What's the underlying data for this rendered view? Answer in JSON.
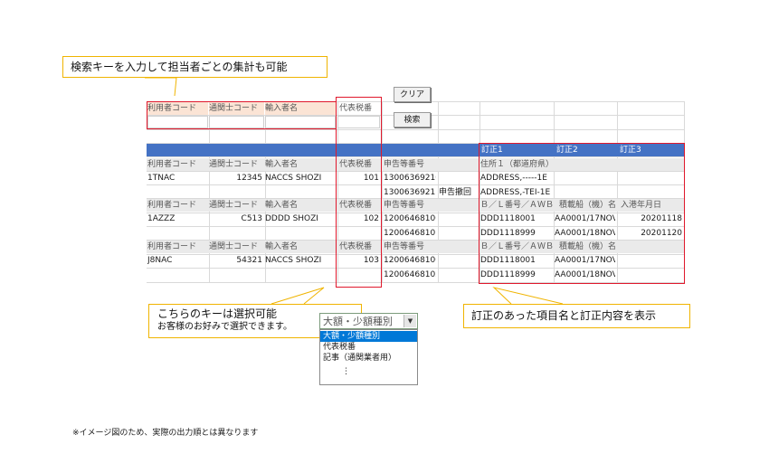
{
  "callouts": {
    "top": "検索キーを入力して担当者ごとの集計も可能",
    "left_line1": "こちらのキーは選択可能",
    "left_line2": "お客様のお好みで選択できます。",
    "right": "訂正のあった項目名と訂正内容を表示"
  },
  "search_form": {
    "headers": [
      "利用者コード",
      "通関士コード",
      "輸入者名",
      "代表税番"
    ],
    "clear_button": "クリア",
    "search_button": "検索"
  },
  "band": {
    "corrections": [
      "訂正1",
      "訂正2",
      "訂正3"
    ]
  },
  "groups": [
    {
      "headers": [
        "利用者コード",
        "通関士コード",
        "輸入者名",
        "代表税番",
        "申告等番号",
        "住所１（都道府県）"
      ],
      "rows": [
        [
          "1TNAC",
          "12345",
          "NACCS SHOZI",
          "101",
          "13006369210",
          "",
          "ADDRESS,-----1E",
          "",
          ""
        ],
        [
          "",
          "",
          "",
          "",
          "13006369211",
          "申告撤回",
          "ADDRESS,-TEI-1E",
          "",
          ""
        ]
      ]
    },
    {
      "headers": [
        "利用者コード",
        "通関士コード",
        "輸入者名",
        "代表税番",
        "申告等番号",
        "Ｂ／Ｌ番号／ＡＷＢ",
        "積載船（機）名",
        "入港年月日"
      ],
      "rows": [
        [
          "1AZZZ",
          "C513",
          "DDDD SHOZI",
          "102",
          "12006468100",
          "",
          "DDD1118001",
          "AA0001/17NOV",
          "20201118"
        ],
        [
          "",
          "",
          "",
          "",
          "12006468101",
          "",
          "DDD1118999",
          "AA0001/18NOV",
          "20201120"
        ]
      ]
    },
    {
      "headers": [
        "利用者コード",
        "通関士コード",
        "輸入者名",
        "代表税番",
        "申告等番号",
        "Ｂ／Ｌ番号／ＡＷＢ",
        "積載船（機）名"
      ],
      "rows": [
        [
          "J8NAC",
          "54321",
          "NACCS SHOZI",
          "103",
          "12006468100",
          "",
          "DDD1118001",
          "AA0001/17NOV",
          ""
        ],
        [
          "",
          "",
          "",
          "",
          "12006468102",
          "",
          "DDD1118999",
          "AA0001/18NOV",
          ""
        ]
      ]
    }
  ],
  "key_selector": {
    "selected": "大額・少額種別",
    "options": [
      "大額・少額種別",
      "代表税番",
      "記事（通関業者用）",
      "⋮"
    ]
  },
  "footnote": "※イメージ図のため、実際の出力順とは異なります",
  "colors": {
    "accent_red": "#e0182c",
    "band_blue": "#4472c4",
    "callout_border": "#f0b400"
  }
}
